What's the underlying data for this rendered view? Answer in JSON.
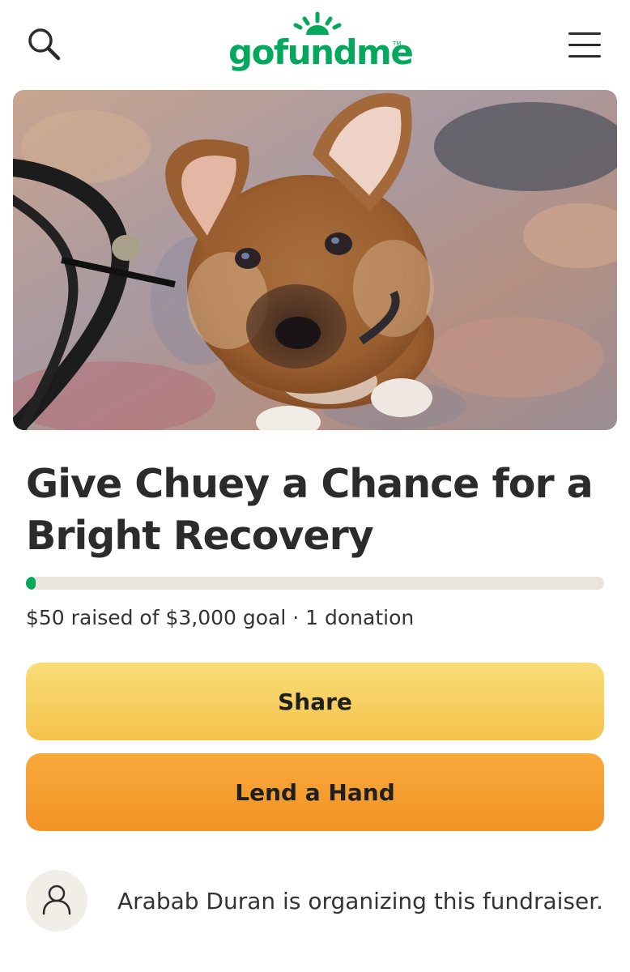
{
  "header": {
    "logo_text": "gofundme",
    "logo_tm": "TM",
    "brand_color": "#02a95c",
    "icons": {
      "search": "search-icon",
      "menu": "hamburger-menu-icon"
    }
  },
  "hero": {
    "image": "puppy-photo"
  },
  "campaign": {
    "title": "Give Chuey a Chance for a Bright Recovery",
    "raised": "$50",
    "goal": "$3,000",
    "stats_text": "$50 raised of $3,000 goal · 1 donation",
    "donations_count": 1,
    "progress_percent": 1.67
  },
  "actions": {
    "share_label": "Share",
    "lend_label": "Lend a Hand",
    "share_color": "#f6cf5c",
    "lend_color": "#f59c30"
  },
  "organizer": {
    "text": "Arabab Duran is organizing this fundraiser.",
    "avatar_icon": "user-icon"
  }
}
